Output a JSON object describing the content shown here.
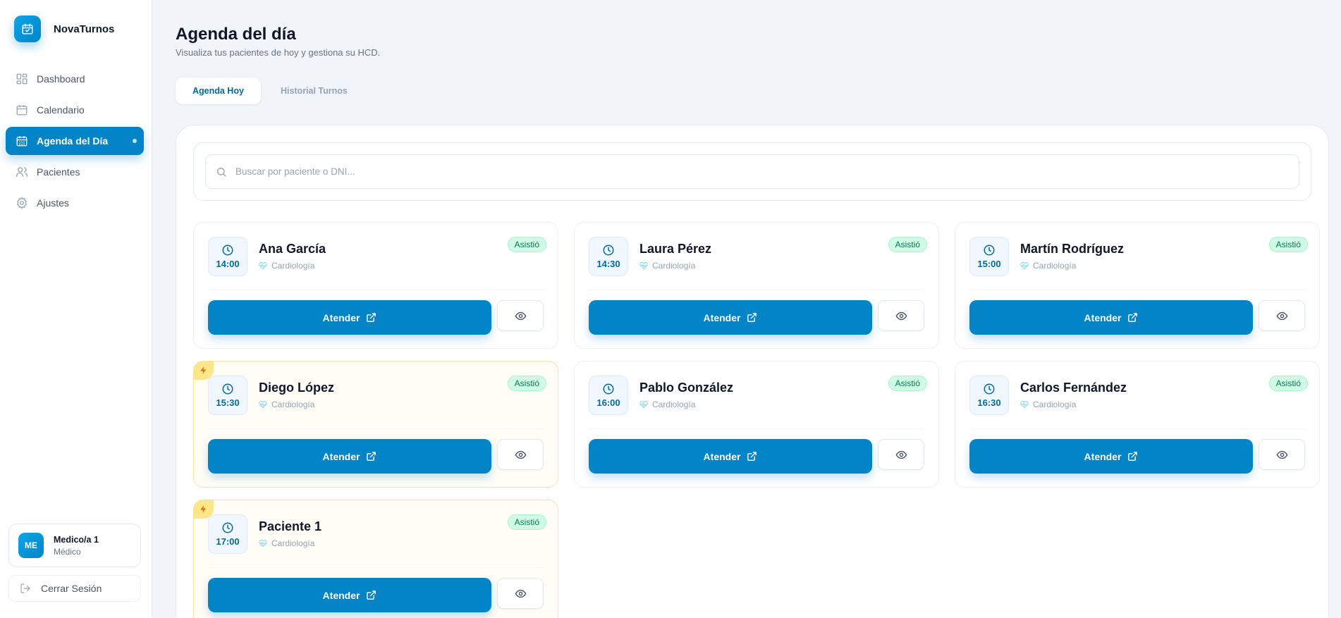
{
  "app": {
    "name": "NovaTurnos"
  },
  "sidebar": {
    "items": [
      {
        "label": "Dashboard",
        "icon": "dashboard-icon",
        "active": false
      },
      {
        "label": "Calendario",
        "icon": "calendar-icon",
        "active": false
      },
      {
        "label": "Agenda del Día",
        "icon": "calendar-grid-icon",
        "active": true
      },
      {
        "label": "Pacientes",
        "icon": "users-icon",
        "active": false
      },
      {
        "label": "Ajustes",
        "icon": "gear-icon",
        "active": false
      }
    ],
    "user": {
      "initials": "ME",
      "name": "Medico/a 1",
      "role": "Médico"
    },
    "logout_label": "Cerrar Sesión"
  },
  "header": {
    "title": "Agenda del día",
    "subtitle": "Visualiza tus pacientes de hoy y gestiona su HCD."
  },
  "tabs": [
    {
      "label": "Agenda Hoy",
      "active": true
    },
    {
      "label": "Historial Turnos",
      "active": false
    }
  ],
  "search": {
    "placeholder": "Buscar por paciente o DNI...",
    "value": ""
  },
  "appointments": [
    {
      "time": "14:00",
      "patient": "Ana García",
      "specialty": "Cardiología",
      "status": "Asistió",
      "urgent": false,
      "action_label": "Atender"
    },
    {
      "time": "14:30",
      "patient": "Laura Pérez",
      "specialty": "Cardiología",
      "status": "Asistió",
      "urgent": false,
      "action_label": "Atender"
    },
    {
      "time": "15:00",
      "patient": "Martín Rodríguez",
      "specialty": "Cardiología",
      "status": "Asistió",
      "urgent": false,
      "action_label": "Atender"
    },
    {
      "time": "15:30",
      "patient": "Diego López",
      "specialty": "Cardiología",
      "status": "Asistió",
      "urgent": true,
      "action_label": "Atender"
    },
    {
      "time": "16:00",
      "patient": "Pablo González",
      "specialty": "Cardiología",
      "status": "Asistió",
      "urgent": false,
      "action_label": "Atender"
    },
    {
      "time": "16:30",
      "patient": "Carlos Fernández",
      "specialty": "Cardiología",
      "status": "Asistió",
      "urgent": false,
      "action_label": "Atender"
    },
    {
      "time": "17:00",
      "patient": "Paciente 1",
      "specialty": "Cardiología",
      "status": "Asistió",
      "urgent": true,
      "action_label": "Atender"
    }
  ],
  "colors": {
    "primary": "#0284c7",
    "status_bg": "#d1fae5",
    "status_text": "#047857",
    "urgent": "#fde68a"
  }
}
